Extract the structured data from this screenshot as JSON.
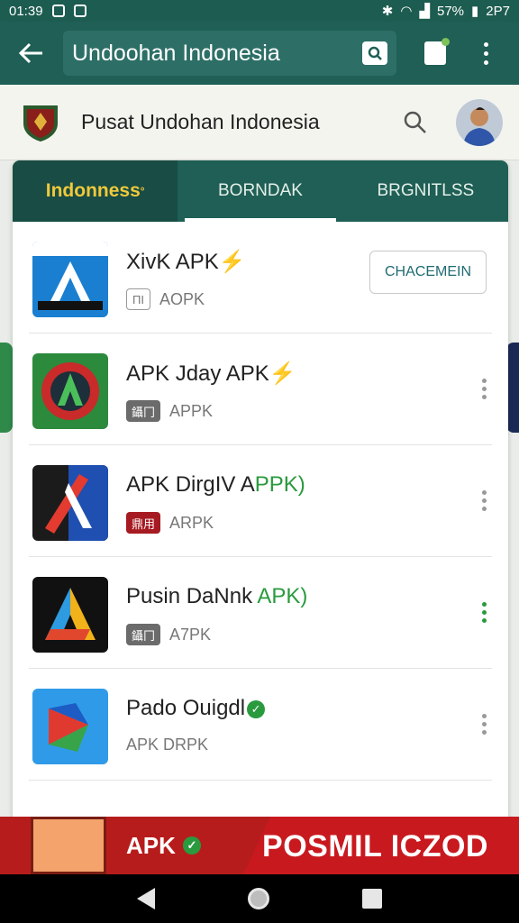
{
  "status_bar": {
    "time": "01:39",
    "battery": "57%",
    "right_time": "2P7"
  },
  "app_bar": {
    "search_value": "Undoohan Indonesia",
    "icons": [
      "back-arrow-icon",
      "search-icon",
      "clipboard-icon",
      "more-vert-icon"
    ]
  },
  "header": {
    "title": "Pusat Undohan Indonesia"
  },
  "tabs": [
    {
      "label": "Indonness",
      "sup": "°"
    },
    {
      "label": "BORNDAK"
    },
    {
      "label": "BRGNITLSS"
    }
  ],
  "apps": [
    {
      "name": "XivK APK",
      "sub": "AOPK",
      "badge": "ΠI",
      "action": "CHACEMEIN"
    },
    {
      "name": "APK Jday APK",
      "sub": "APPK",
      "badge": "鑷冂"
    },
    {
      "name": "APK DirgIV A",
      "name_hl": "PPK)",
      "sub": "ARPK",
      "badge": "鼎用"
    },
    {
      "name": "Pusin DaNnk ",
      "name_hl": "APK)",
      "sub": "A7PK",
      "badge": "鑷冂"
    },
    {
      "name": "Pado Ouigdl",
      "sub": "APK DRPK"
    }
  ],
  "banner": {
    "left": "APK",
    "right": "POSMIL ICZOD"
  },
  "colors": {
    "primary": "#1f5f55",
    "accent_green": "#2a9a3e",
    "banner_red": "#b71c1c",
    "tab_highlight": "#f0c93b"
  }
}
